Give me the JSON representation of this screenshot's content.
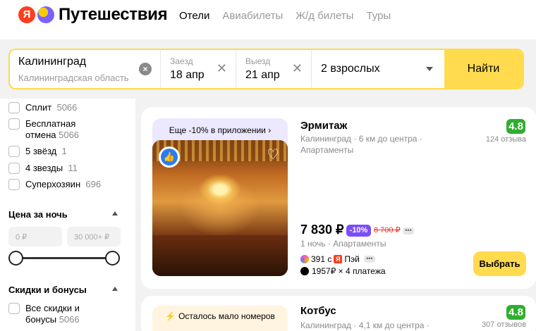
{
  "header": {
    "logo_letter": "Я",
    "brand": "Путешествия",
    "nav": [
      "Отели",
      "Авиабилеты",
      "Ж/д билеты",
      "Туры"
    ]
  },
  "search": {
    "city": "Калининград",
    "city_region": "Калининградская область",
    "checkin_label": "Заезд",
    "checkin_value": "18 апр",
    "checkout_label": "Выезд",
    "checkout_value": "21 апр",
    "guests": "2 взрослых",
    "find_label": "Найти"
  },
  "sidebar": {
    "amenities": [
      {
        "label": "Сплит",
        "count": "5066"
      },
      {
        "label": "Бесплатная отмена",
        "count": "5066"
      },
      {
        "label": "5 звёзд",
        "count": "1"
      },
      {
        "label": "4 звезды",
        "count": "11"
      },
      {
        "label": "Суперхозяин",
        "count": "696"
      }
    ],
    "price_heading": "Цена за ночь",
    "price_min_placeholder": "0 ₽",
    "price_max_placeholder": "30 000+ ₽",
    "discounts_heading": "Скидки и бонусы",
    "discounts_item": {
      "label": "Все скидки и бонусы",
      "count": "5066"
    }
  },
  "hotels": [
    {
      "promo": "Еще -10% в приложении ›",
      "name": "Эрмитаж",
      "location": "Калининград · 6 км до центра ·",
      "type": "Апартаменты",
      "rating": "4.8",
      "reviews": "124 отзыва",
      "price": "7 830 ₽",
      "discount": "-10%",
      "old_price": "8 700 ₽",
      "nights": "1 ночь · Апартаменты",
      "cashback_amount": "391 с",
      "pay_label": "Пэй",
      "split": "1957₽ × 4 платежа",
      "select_label": "Выбрать"
    },
    {
      "promo": "Осталось мало номеров",
      "name": "Котбус",
      "location": "Калининград · 4,1 км до центра ·",
      "rating": "4.8",
      "reviews": "307 отзывов"
    }
  ],
  "colors": {
    "accent": "#ffdb4d",
    "rating_green": "#2fae2f",
    "discount_purple": "#7b4dff",
    "old_price_red": "#e0382c",
    "brand_red": "#fc3f1d"
  }
}
